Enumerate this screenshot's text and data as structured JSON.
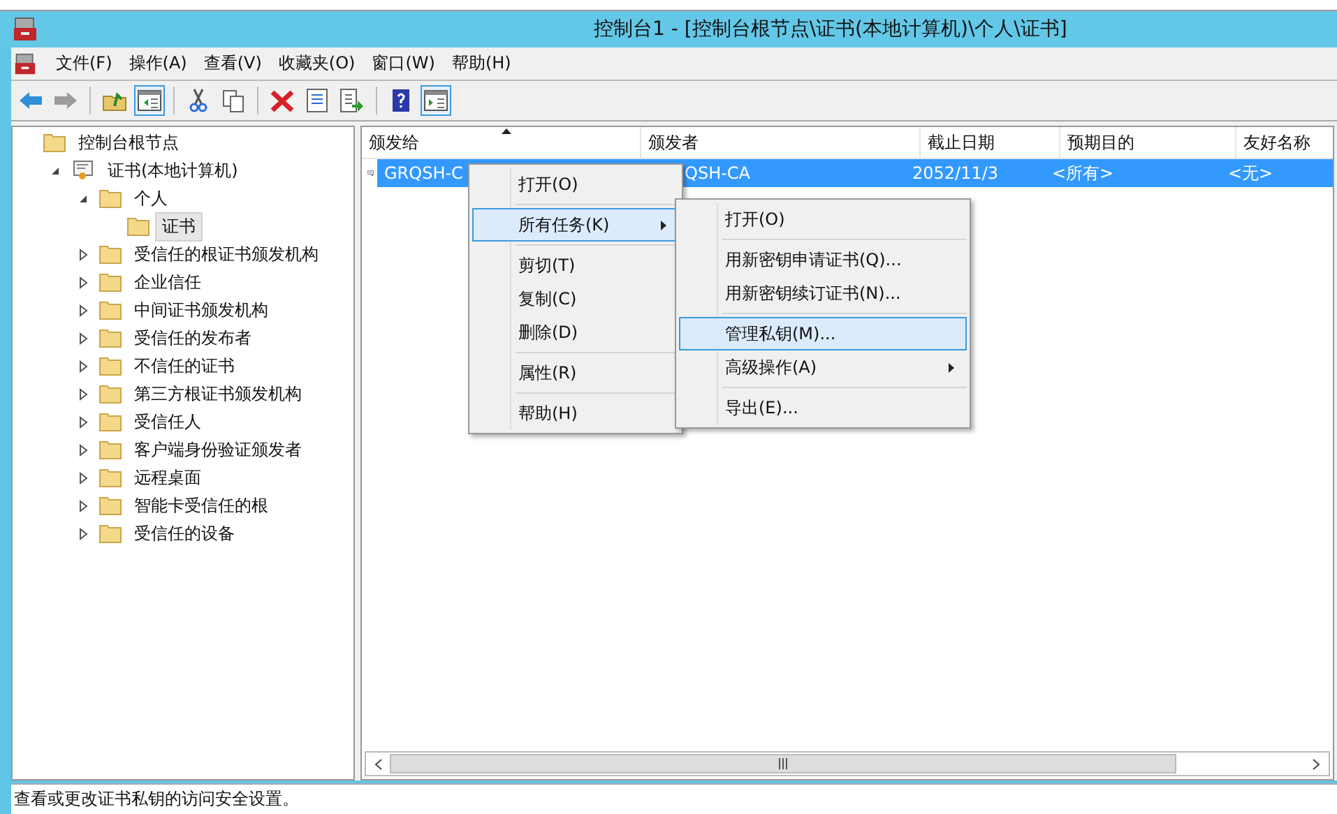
{
  "window": {
    "title": "控制台1 - [控制台根节点\\证书(本地计算机)\\个人\\证书]"
  },
  "menu_bar": [
    "文件(F)",
    "操作(A)",
    "查看(V)",
    "收藏夹(O)",
    "窗口(W)",
    "帮助(H)"
  ],
  "toolbar": [
    {
      "kind": "back",
      "pressed": false,
      "disabled": false
    },
    {
      "kind": "forward",
      "pressed": false,
      "disabled": true
    },
    {
      "kind": "sep"
    },
    {
      "kind": "up",
      "pressed": false,
      "disabled": false
    },
    {
      "kind": "tree",
      "pressed": true,
      "disabled": false
    },
    {
      "kind": "sep"
    },
    {
      "kind": "cut",
      "pressed": false,
      "disabled": false
    },
    {
      "kind": "copy",
      "pressed": false,
      "disabled": false
    },
    {
      "kind": "sep"
    },
    {
      "kind": "delete",
      "pressed": false,
      "disabled": false
    },
    {
      "kind": "properties",
      "pressed": false,
      "disabled": false
    },
    {
      "kind": "export",
      "pressed": false,
      "disabled": false
    },
    {
      "kind": "sep"
    },
    {
      "kind": "help",
      "pressed": false,
      "disabled": false
    },
    {
      "kind": "actionpane",
      "pressed": true,
      "disabled": false
    }
  ],
  "tree": [
    {
      "label": "控制台根节点",
      "kind": "folder",
      "selected": false,
      "children": [
        {
          "label": "证书(本地计算机)",
          "kind": "cert",
          "expanded": true,
          "selected": false,
          "children": [
            {
              "label": "个人",
              "kind": "folder",
              "expanded": true,
              "selected": false,
              "children": [
                {
                  "label": "证书",
                  "kind": "folder",
                  "selected": true
                }
              ]
            },
            {
              "label": "受信任的根证书颁发机构",
              "kind": "folder",
              "expanded": false,
              "selected": false
            },
            {
              "label": "企业信任",
              "kind": "folder",
              "expanded": false,
              "selected": false
            },
            {
              "label": "中间证书颁发机构",
              "kind": "folder",
              "expanded": false,
              "selected": false
            },
            {
              "label": "受信任的发布者",
              "kind": "folder",
              "expanded": false,
              "selected": false
            },
            {
              "label": "不信任的证书",
              "kind": "folder",
              "expanded": false,
              "selected": false
            },
            {
              "label": "第三方根证书颁发机构",
              "kind": "folder",
              "expanded": false,
              "selected": false
            },
            {
              "label": "受信任人",
              "kind": "folder",
              "expanded": false,
              "selected": false
            },
            {
              "label": "客户端身份验证颁发者",
              "kind": "folder",
              "expanded": false,
              "selected": false
            },
            {
              "label": "远程桌面",
              "kind": "folder",
              "expanded": false,
              "selected": false
            },
            {
              "label": "智能卡受信任的根",
              "kind": "folder",
              "expanded": false,
              "selected": false
            },
            {
              "label": "受信任的设备",
              "kind": "folder",
              "expanded": false,
              "selected": false
            }
          ]
        }
      ]
    }
  ],
  "table": {
    "columns": [
      {
        "label": "颁发给",
        "sorted": true
      },
      {
        "label": "颁发者",
        "sorted": false
      },
      {
        "label": "截止日期",
        "sorted": false
      },
      {
        "label": "预期目的",
        "sorted": false
      },
      {
        "label": "友好名称",
        "sorted": false
      }
    ],
    "rows": [
      {
        "selected": true,
        "cells": [
          "GRQSH-C",
          "QSH-CA",
          "2052/11/3",
          "<所有>",
          "<无>"
        ]
      }
    ]
  },
  "context_menu": [
    {
      "kind": "item",
      "label": "打开(O)",
      "selected": false,
      "submenu": false
    },
    {
      "kind": "separator"
    },
    {
      "kind": "item",
      "label": "所有任务(K)",
      "selected": true,
      "submenu": true
    },
    {
      "kind": "separator"
    },
    {
      "kind": "item",
      "label": "剪切(T)",
      "selected": false,
      "submenu": false
    },
    {
      "kind": "item",
      "label": "复制(C)",
      "selected": false,
      "submenu": false
    },
    {
      "kind": "item",
      "label": "删除(D)",
      "selected": false,
      "submenu": false
    },
    {
      "kind": "separator"
    },
    {
      "kind": "item",
      "label": "属性(R)",
      "selected": false,
      "submenu": false
    },
    {
      "kind": "separator"
    },
    {
      "kind": "item",
      "label": "帮助(H)",
      "selected": false,
      "submenu": false
    }
  ],
  "submenu": [
    {
      "kind": "item",
      "label": "打开(O)",
      "selected": false,
      "submenu": false
    },
    {
      "kind": "separator"
    },
    {
      "kind": "item",
      "label": "用新密钥申请证书(Q)...",
      "selected": false,
      "submenu": false
    },
    {
      "kind": "item",
      "label": "用新密钥续订证书(N)...",
      "selected": false,
      "submenu": false
    },
    {
      "kind": "separator"
    },
    {
      "kind": "item",
      "label": "管理私钥(M)...",
      "selected": true,
      "submenu": false
    },
    {
      "kind": "item",
      "label": "高级操作(A)",
      "selected": false,
      "submenu": true
    },
    {
      "kind": "separator"
    },
    {
      "kind": "item",
      "label": "导出(E)...",
      "selected": false,
      "submenu": false
    }
  ],
  "status_bar": "查看或更改证书私钥的访问安全设置。"
}
